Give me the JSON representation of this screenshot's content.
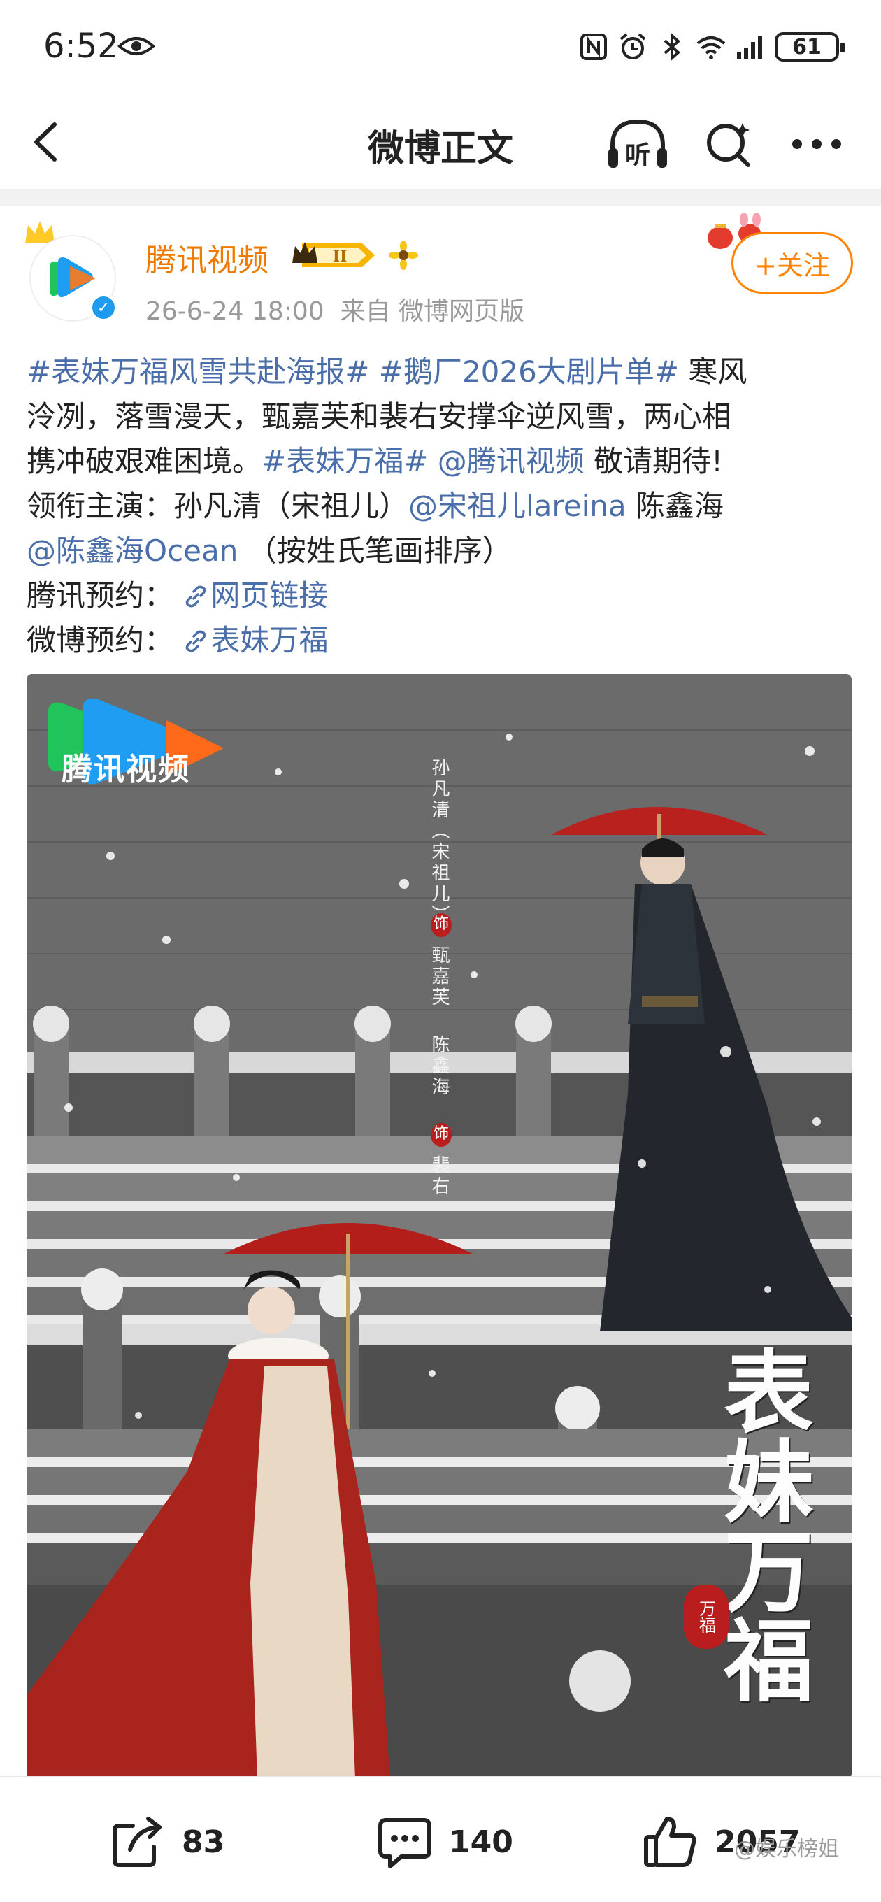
{
  "status_bar": {
    "time": "6:52",
    "battery": "61",
    "icons": [
      "eye-icon",
      "nfc-icon",
      "alarm-icon",
      "bluetooth-icon",
      "wifi-icon",
      "signal-icon",
      "battery-icon"
    ]
  },
  "navbar": {
    "title": "微博正文",
    "listen_label": "听"
  },
  "post": {
    "author": "腾讯视频",
    "level": "II",
    "timestamp": "26-6-24 18:00",
    "source": "来自 微博网页版",
    "follow_label": "+关注",
    "lines": {
      "l1_tag1": "#表妹万福风雪共赴海报#",
      "l1_tag2": "#鹅厂2026大剧片单#",
      "l1_text": " 寒风",
      "l2_text": "泠冽，落雪漫天，甄嘉芙和裴右安撑伞逆风雪，两心相",
      "l3_text1": "携冲破艰难困境。",
      "l3_tag": "#表妹万福#",
      "l3_mention": "@腾讯视频",
      "l3_text2": " 敬请期待!",
      "l4_text1": "领衔主演：孙凡清（宋祖儿）",
      "l4_mention": "@宋祖儿lareina",
      "l4_text2": " 陈鑫海",
      "l5_mention": "@陈鑫海Ocean",
      "l5_text": " （按姓氏笔画排序）",
      "l6_label": "腾讯预约：",
      "l6_link": "网页链接",
      "l7_label": "微博预约：",
      "l7_link": "表妹万福"
    },
    "poster": {
      "logo": "腾讯视频",
      "cast_1": "孙凡清（宋祖儿）",
      "role_1": "甄嘉芙",
      "cast_2": "陈鑫海",
      "role_2": "裴右",
      "shi": "饰",
      "title": "表妹万福",
      "seal": "万福"
    }
  },
  "actions": {
    "shares": "83",
    "comments": "140",
    "likes": "2057"
  },
  "watermark": "@娱乐榜姐",
  "colors": {
    "author": "#ef7a00",
    "tag": "#4a6ea9",
    "follow": "#ff8200"
  }
}
